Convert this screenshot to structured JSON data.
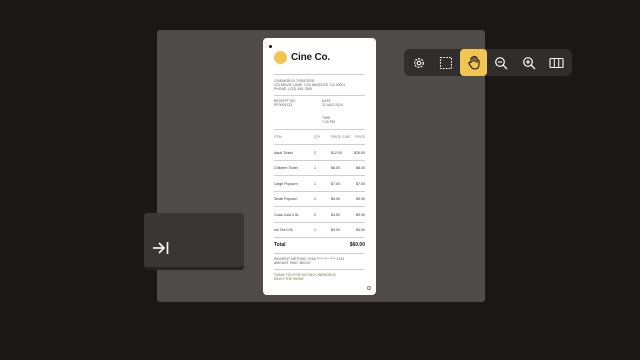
{
  "toolbar": {
    "tools": [
      {
        "name": "settings",
        "icon": "gear-icon",
        "active": false
      },
      {
        "name": "select",
        "icon": "marquee-select-icon",
        "active": false
      },
      {
        "name": "pan",
        "icon": "hand-icon",
        "active": true
      },
      {
        "name": "zoom-out",
        "icon": "zoom-out-icon",
        "active": false
      },
      {
        "name": "zoom-in",
        "icon": "zoom-in-icon",
        "active": false
      },
      {
        "name": "split-view",
        "icon": "columns-icon",
        "active": false
      }
    ],
    "accent": "#f2c552"
  },
  "sidebar_toggle": {
    "icon": "arrow-right-to-bar-icon"
  },
  "receipt": {
    "brand": "Cine Co.",
    "theater_name": "CINEWORLD THEATERS",
    "address": "123 MOVIE LANE, LOS ANGELES, CA 90001",
    "phone": "PHONE: (123) 456-7890",
    "receipt_label": "RECEIPT NO.",
    "receipt_no": "RF0000123",
    "date_label": "DATE",
    "date": "22 AUG 2024",
    "time_label": "TIME",
    "time": "7:40 PM",
    "columns": {
      "item": "ITEM",
      "qty": "QTY",
      "price": "PRICE / UNIT",
      "total": "PRICE"
    },
    "items": [
      {
        "item": "Adult Ticket",
        "qty": "2",
        "price": "$12.00",
        "total": "$26.00"
      },
      {
        "item": "Children Ticket",
        "qty": "1",
        "price": "$8.00",
        "total": "$8.00"
      },
      {
        "item": "Large Popcorn",
        "qty": "1",
        "price": "$7.00",
        "total": "$7.00"
      },
      {
        "item": "Small Popcorn",
        "qty": "1",
        "price": "$5.00",
        "total": "$5.00"
      },
      {
        "item": "Coca-Cola 0.5L",
        "qty": "2",
        "price": "$4.50",
        "total": "$9.00"
      },
      {
        "item": "Ice Tea 0.5L",
        "qty": "1",
        "price": "$4.00",
        "total": "$4.00"
      }
    ],
    "total_label": "Total",
    "total": "$60.00",
    "payment_method": "PAYMENT METHOD: VISA **** **** **** 1234",
    "amount_paid": "AMOUNT PAID: $60.00",
    "thanks_1": "THANK YOU FOR VISITING CINEWORLD!",
    "thanks_2": "ENJOY THE SHOW!"
  }
}
